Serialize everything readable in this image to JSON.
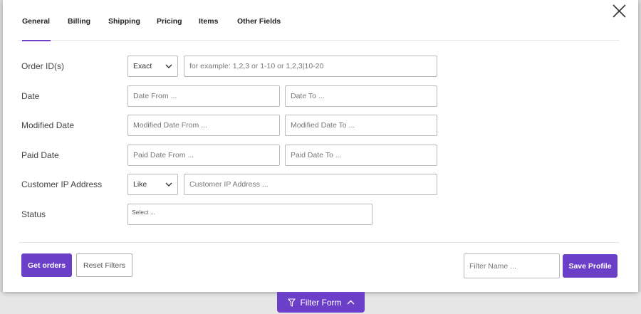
{
  "tabs": [
    {
      "label": "General",
      "active": true
    },
    {
      "label": "Billing",
      "active": false
    },
    {
      "label": "Shipping",
      "active": false
    },
    {
      "label": "Pricing",
      "active": false
    },
    {
      "label": "Items",
      "active": false
    },
    {
      "label": "Other Fields",
      "active": false
    }
  ],
  "form": {
    "order_ids": {
      "label": "Order ID(s)",
      "match_value": "Exact",
      "placeholder": "for example: 1,2,3 or 1-10 or 1,2,3|10-20"
    },
    "date": {
      "label": "Date",
      "from_placeholder": "Date From ...",
      "to_placeholder": "Date To ..."
    },
    "modified_date": {
      "label": "Modified Date",
      "from_placeholder": "Modified Date From ...",
      "to_placeholder": "Modified Date To ..."
    },
    "paid_date": {
      "label": "Paid Date",
      "from_placeholder": "Paid Date From ...",
      "to_placeholder": "Paid Date To ..."
    },
    "customer_ip": {
      "label": "Customer IP Address",
      "match_value": "Like",
      "placeholder": "Customer IP Address ..."
    },
    "status": {
      "label": "Status",
      "placeholder": "Select ..."
    }
  },
  "actions": {
    "get_orders": "Get orders",
    "reset_filters": "Reset Filters",
    "filter_name_placeholder": "Filter Name ...",
    "save_profile": "Save Profile"
  },
  "filter_toggle": {
    "label": "Filter Form"
  },
  "icons": {
    "close": "close-icon",
    "dropdown": "chevron-down-icon",
    "filter": "funnel-icon",
    "collapse": "chevron-up-icon"
  },
  "colors": {
    "accent": "#6c3fc9",
    "border": "#b9b9b9",
    "text": "#333333"
  }
}
